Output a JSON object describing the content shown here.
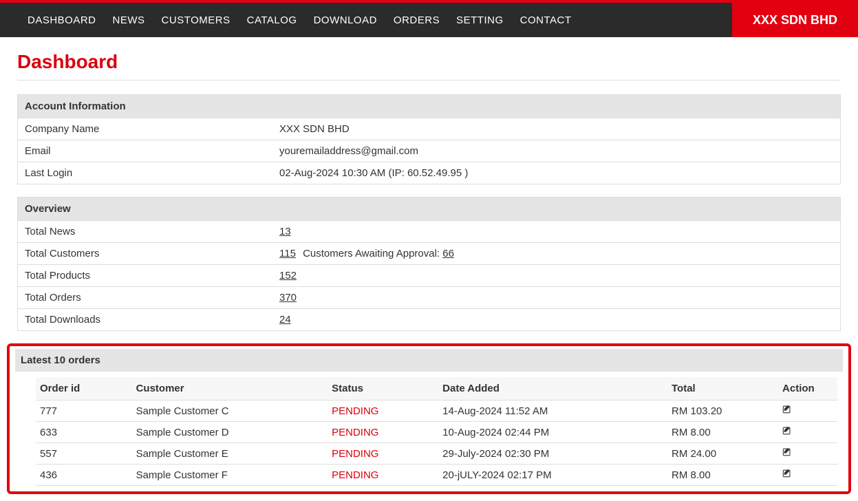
{
  "nav": {
    "items": [
      "DASHBOARD",
      "NEWS",
      "CUSTOMERS",
      "CATALOG",
      "DOWNLOAD",
      "ORDERS",
      "SETTING",
      "CONTACT"
    ],
    "brand": "XXX SDN BHD"
  },
  "page": {
    "title": "Dashboard"
  },
  "account": {
    "heading": "Account Information",
    "rows": {
      "company_label": "Company Name",
      "company_value": "XXX SDN BHD",
      "email_label": "Email",
      "email_value": "youremailaddress@gmail.com",
      "lastlogin_label": "Last Login",
      "lastlogin_value": "02-Aug-2024 10:30 AM  (IP: 60.52.49.95 )"
    }
  },
  "overview": {
    "heading": "Overview",
    "news_label": "Total News",
    "news_value": "13",
    "customers_label": "Total Customers",
    "customers_value": "115",
    "awaiting_label": "Customers Awaiting Approval:",
    "awaiting_value": "66",
    "products_label": "Total Products",
    "products_value": "152",
    "orders_label": "Total Orders",
    "orders_value": "370",
    "downloads_label": "Total Downloads",
    "downloads_value": "24"
  },
  "latest_orders": {
    "heading": "Latest 10 orders",
    "columns": {
      "id": "Order id",
      "customer": "Customer",
      "status": "Status",
      "date": "Date Added",
      "total": "Total",
      "action": "Action"
    },
    "rows": [
      {
        "id": "777",
        "customer": "Sample Customer C",
        "status": "PENDING",
        "date": "14-Aug-2024 11:52 AM",
        "total": "RM 103.20"
      },
      {
        "id": "633",
        "customer": "Sample Customer D",
        "status": "PENDING",
        "date": "10-Aug-2024 02:44 PM",
        "total": "RM 8.00"
      },
      {
        "id": "557",
        "customer": "Sample Customer E",
        "status": "PENDING",
        "date": "29-July-2024 02:30 PM",
        "total": "RM 24.00"
      },
      {
        "id": "436",
        "customer": "Sample Customer F",
        "status": "PENDING",
        "date": "20-jULY-2024 02:17 PM",
        "total": "RM 8.00"
      }
    ]
  }
}
